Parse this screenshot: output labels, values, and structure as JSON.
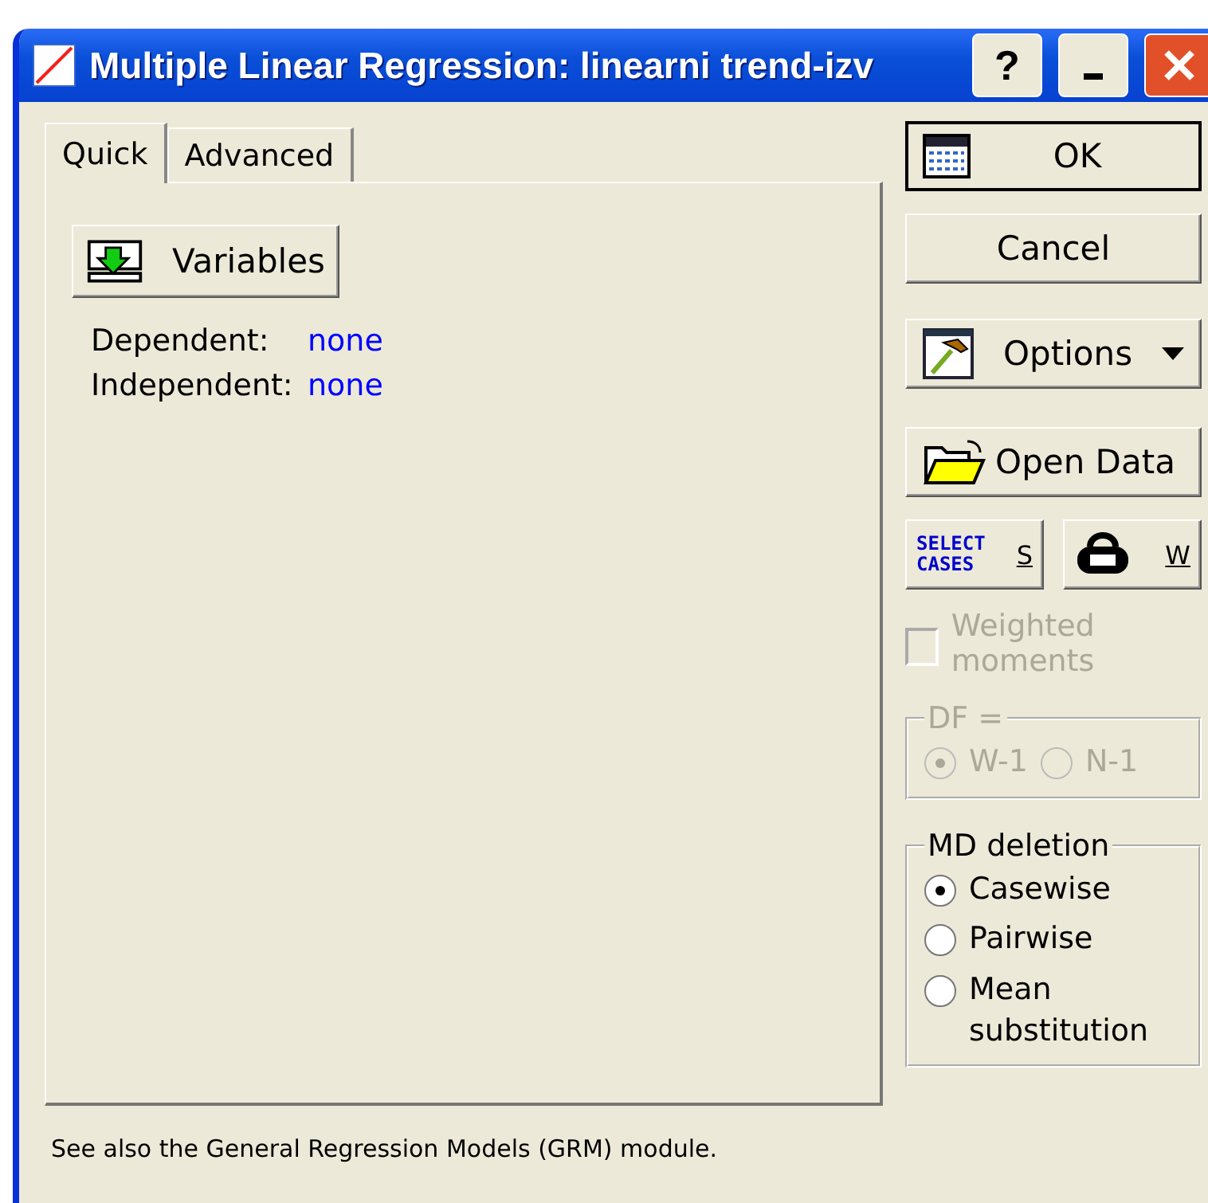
{
  "window": {
    "title": "Multiple Linear Regression: linearni trend-izv",
    "buttons": [
      {
        "kind": "help",
        "label": "?"
      },
      {
        "kind": "minimize"
      },
      {
        "kind": "close"
      }
    ]
  },
  "tabs": [
    {
      "label": "Quick",
      "selected": true
    },
    {
      "label": "Advanced",
      "selected": false
    }
  ],
  "variables_button": {
    "label": "Variables"
  },
  "fields": [
    {
      "label": "Dependent:",
      "value": "none"
    },
    {
      "label": "Independent:",
      "value": "none"
    }
  ],
  "actions": [
    {
      "kind": "ok",
      "label": "OK",
      "default": true
    },
    {
      "kind": "cancel",
      "label": "Cancel",
      "default": false
    },
    {
      "kind": "options",
      "label": "Options",
      "default": false
    },
    {
      "kind": "open",
      "label": "Open Data",
      "default": false
    }
  ],
  "small_buttons": [
    {
      "kind": "select_cases",
      "label": "SELECT CASES",
      "key": "S"
    },
    {
      "kind": "weight",
      "key": "W"
    }
  ],
  "weighted_moments": {
    "label": "Weighted moments",
    "checked": false,
    "disabled": true
  },
  "df_group": {
    "title": "DF =",
    "disabled": true,
    "options": [
      {
        "label": "W-1",
        "selected": true
      },
      {
        "label": "N-1",
        "selected": false
      }
    ]
  },
  "md_deletion": {
    "title": "MD deletion",
    "disabled": false,
    "options": [
      {
        "label": "Casewise",
        "selected": true
      },
      {
        "label": "Pairwise",
        "selected": false
      },
      {
        "label": "Mean substitution",
        "selected": false
      }
    ]
  },
  "footer": "See also the General Regression Models (GRM) module."
}
